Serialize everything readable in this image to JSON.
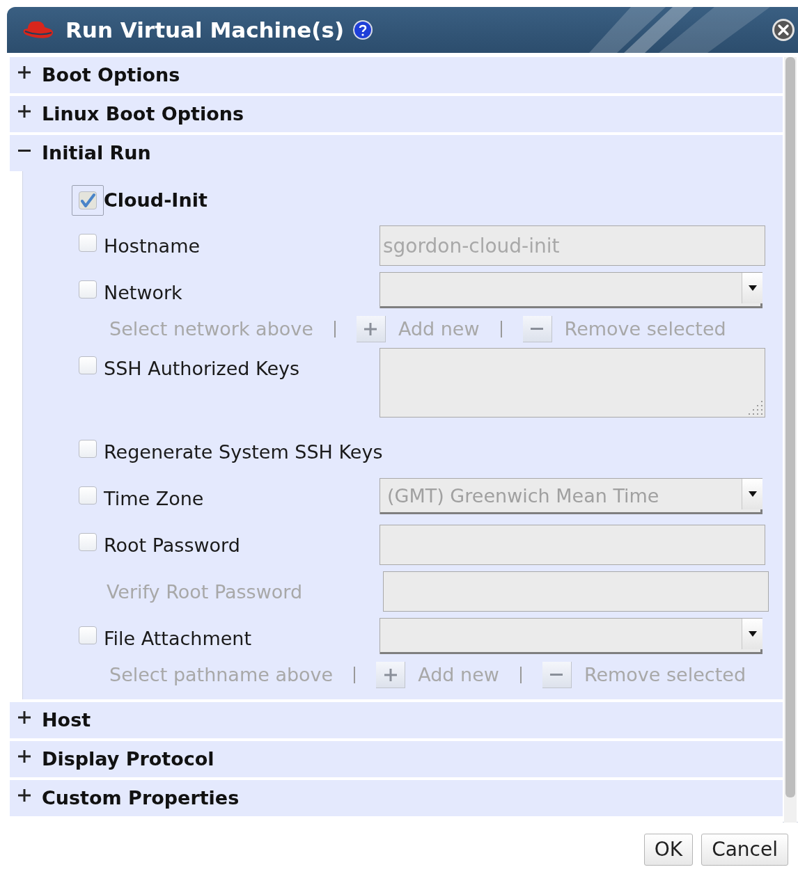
{
  "dialog": {
    "title": "Run Virtual Machine(s)"
  },
  "sections": [
    {
      "title": "Boot Options",
      "expanded": false
    },
    {
      "title": "Linux Boot Options",
      "expanded": false
    },
    {
      "title": "Initial Run",
      "expanded": true,
      "cloud_init": {
        "label": "Cloud-Init",
        "checked": true
      },
      "fields": [
        {
          "kind": "text",
          "label": "Hostname",
          "checked": false,
          "value": "sgordon-cloud-init"
        },
        {
          "kind": "select",
          "label": "Network",
          "checked": false
        },
        {
          "kind": "list_actions",
          "hint": "Select network above",
          "add": "Add new",
          "remove": "Remove selected"
        },
        {
          "kind": "textarea",
          "label": "SSH Authorized Keys",
          "checked": false
        },
        {
          "kind": "checkbox",
          "label": "Regenerate System SSH Keys",
          "checked": false
        },
        {
          "kind": "select",
          "label": "Time Zone",
          "checked": false,
          "value": "(GMT) Greenwich Mean Time"
        },
        {
          "kind": "text",
          "label": "Root Password",
          "checked": false
        },
        {
          "kind": "text",
          "label": "Verify Root Password"
        },
        {
          "kind": "select",
          "label": "File Attachment",
          "checked": false
        },
        {
          "kind": "list_actions",
          "hint": "Select pathname above",
          "add": "Add new",
          "remove": "Remove selected"
        }
      ]
    },
    {
      "title": "Host",
      "expanded": false
    },
    {
      "title": "Display Protocol",
      "expanded": false
    },
    {
      "title": "Custom Properties",
      "expanded": false
    }
  ],
  "buttons": [
    "OK",
    "Cancel"
  ]
}
